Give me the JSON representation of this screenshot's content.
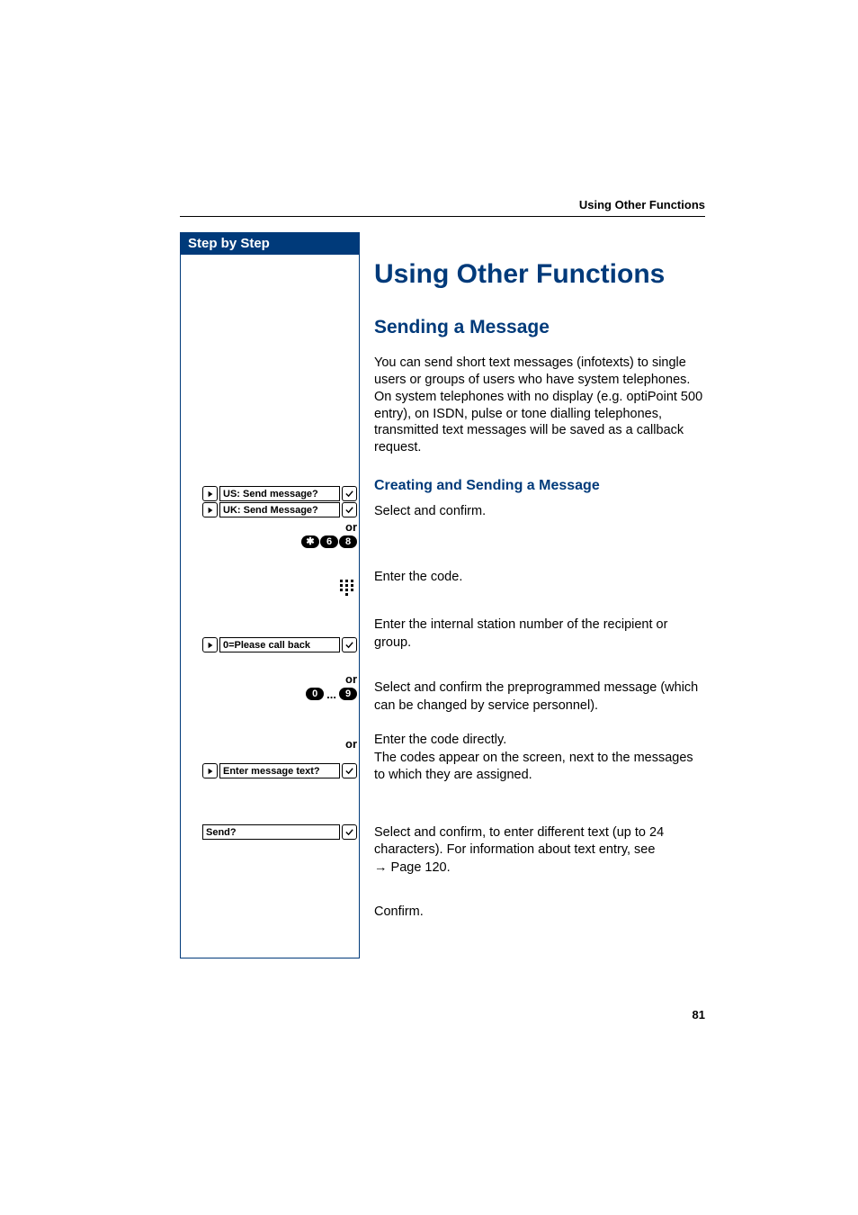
{
  "running_header": "Using Other Functions",
  "page_number": "81",
  "left": {
    "step_header": "Step by Step",
    "menu": {
      "us_send": "US: Send message?",
      "uk_send": "UK: Send Message?",
      "please_call": "0=Please call back",
      "enter_text": "Enter message text?",
      "send": "Send?"
    },
    "or": "or",
    "code_keys": {
      "star": "✱",
      "k6": "6",
      "k8": "8",
      "k0": "0",
      "k9": "9"
    },
    "dots": "..."
  },
  "right": {
    "h1": "Using Other Functions",
    "h2": "Sending a Message",
    "intro": "You can send short text messages (infotexts) to single users or groups of users who have system telephones. On system telephones with no display (e.g. optiPoint 500 entry), on ISDN, pulse or tone dialling telephones, transmitted text messages will be saved as a callback request.",
    "h3": "Creating and Sending a Message",
    "line_select": "Select and confirm.",
    "line_code": "Enter the code.",
    "line_station": "Enter the internal station number of the recipient or group.",
    "line_preprog": "Select and confirm the preprogrammed message (which can be changed by service personnel).",
    "line_direct1": "Enter the code directly.",
    "line_direct2": "The codes appear on the screen, next to the messages to which they are assigned.",
    "line_entertext": "Select and confirm, to enter different text (up to 24 characters). For information about text entry, see ",
    "page_ref": "Page 120.",
    "line_confirm": "Confirm."
  }
}
